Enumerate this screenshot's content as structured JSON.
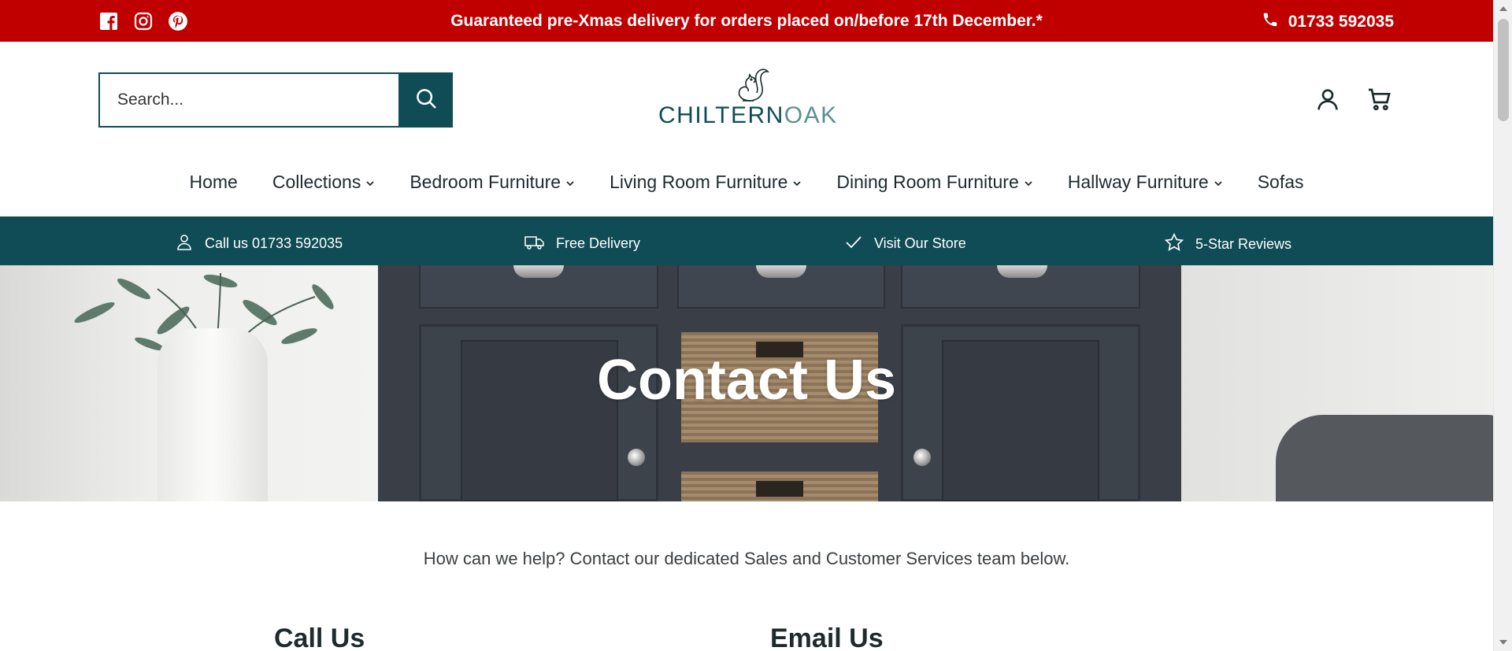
{
  "topbar": {
    "promo": "Guaranteed pre-Xmas delivery for orders placed on/before 17th December.*",
    "phone": "01733 592035",
    "socials": [
      "facebook-icon",
      "instagram-icon",
      "pinterest-icon"
    ],
    "bg_color": "#c00000"
  },
  "header": {
    "search_placeholder": "Search...",
    "logo_main": "CHILTERN",
    "logo_light": "OAK",
    "icons": [
      "account-icon",
      "cart-icon"
    ]
  },
  "nav": {
    "items": [
      {
        "label": "Home",
        "has_dropdown": false
      },
      {
        "label": "Collections",
        "has_dropdown": true
      },
      {
        "label": "Bedroom Furniture",
        "has_dropdown": true
      },
      {
        "label": "Living Room Furniture",
        "has_dropdown": true
      },
      {
        "label": "Dining Room Furniture",
        "has_dropdown": true
      },
      {
        "label": "Hallway Furniture",
        "has_dropdown": true
      },
      {
        "label": "Sofas",
        "has_dropdown": false
      }
    ]
  },
  "usp": {
    "bg_color": "#0f4c56",
    "items": [
      {
        "label": "Call us 01733 592035",
        "icon": "person-icon"
      },
      {
        "label": "Free Delivery",
        "icon": "truck-icon"
      },
      {
        "label": "Visit Our Store",
        "icon": "checkmark-icon"
      },
      {
        "label": "5-Star Reviews",
        "icon": "star-icon"
      }
    ]
  },
  "hero": {
    "title": "Contact Us"
  },
  "content": {
    "intro": "How can we help? Contact our dedicated Sales and Customer Services team below.",
    "call_heading": "Call Us",
    "email_heading": "Email Us"
  }
}
